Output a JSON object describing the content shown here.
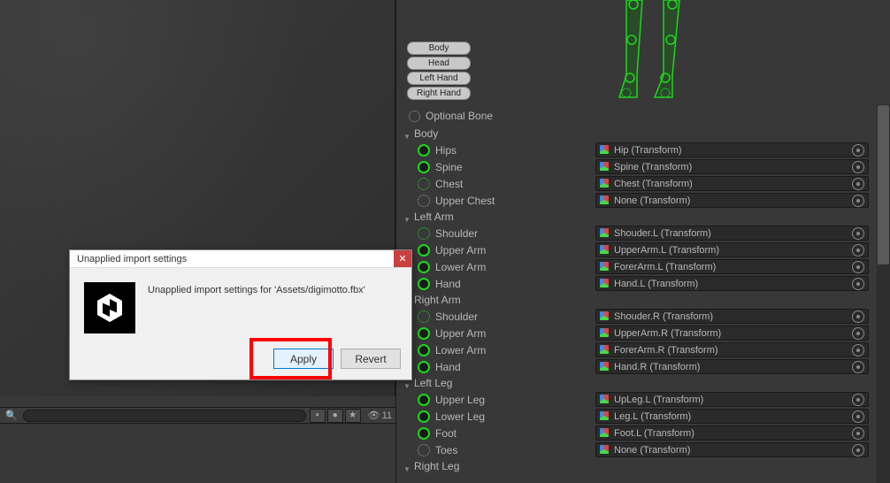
{
  "sceneView": {},
  "bottomBar": {
    "searchPlaceholder": "",
    "count": "11"
  },
  "bodyButtons": {
    "body": "Body",
    "head": "Head",
    "leftHand": "Left Hand",
    "rightHand": "Right Hand"
  },
  "optionalBone": "Optional Bone",
  "sections": {
    "body": {
      "label": "Body",
      "bones": [
        {
          "name": "Hips",
          "indicator": "solid",
          "transform": "Hip (Transform)"
        },
        {
          "name": "Spine",
          "indicator": "solid",
          "transform": "Spine (Transform)"
        },
        {
          "name": "Chest",
          "indicator": "dotted",
          "transform": "Chest (Transform)"
        },
        {
          "name": "Upper Chest",
          "indicator": "dotted-gray",
          "transform": "None (Transform)"
        }
      ]
    },
    "leftArm": {
      "label": "Left Arm",
      "bones": [
        {
          "name": "Shoulder",
          "indicator": "dotted",
          "transform": "Shouder.L (Transform)"
        },
        {
          "name": "Upper Arm",
          "indicator": "solid",
          "transform": "UpperArm.L (Transform)"
        },
        {
          "name": "Lower Arm",
          "indicator": "solid",
          "transform": "ForerArm.L (Transform)"
        },
        {
          "name": "Hand",
          "indicator": "solid",
          "transform": "Hand.L (Transform)"
        }
      ]
    },
    "rightArm": {
      "label": "Right Arm",
      "bones": [
        {
          "name": "Shoulder",
          "indicator": "dotted",
          "transform": "Shouder.R (Transform)"
        },
        {
          "name": "Upper Arm",
          "indicator": "solid",
          "transform": "UpperArm.R (Transform)"
        },
        {
          "name": "Lower Arm",
          "indicator": "solid",
          "transform": "ForerArm.R (Transform)"
        },
        {
          "name": "Hand",
          "indicator": "solid",
          "transform": "Hand.R (Transform)"
        }
      ]
    },
    "leftLeg": {
      "label": "Left Leg",
      "bones": [
        {
          "name": "Upper Leg",
          "indicator": "solid",
          "transform": "UpLeg.L (Transform)"
        },
        {
          "name": "Lower Leg",
          "indicator": "solid",
          "transform": "Leg.L (Transform)"
        },
        {
          "name": "Foot",
          "indicator": "solid",
          "transform": "Foot.L (Transform)"
        },
        {
          "name": "Toes",
          "indicator": "dotted-gray",
          "transform": "None (Transform)"
        }
      ]
    },
    "rightLeg": {
      "label": "Right Leg"
    }
  },
  "dialog": {
    "title": "Unapplied import settings",
    "message": "Unapplied import settings for 'Assets/digimotto.fbx'",
    "applyLabel": "Apply",
    "revertLabel": "Revert"
  }
}
